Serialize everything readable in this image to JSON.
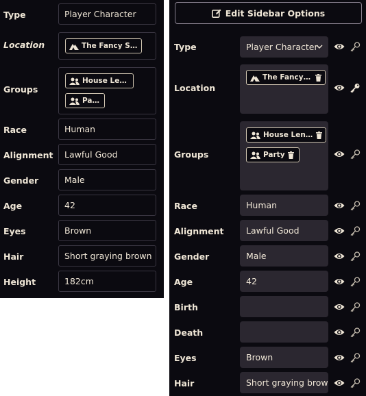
{
  "left": {
    "fields": [
      {
        "label": "Type",
        "value": "Player Character"
      },
      {
        "label": "Location",
        "tags": [
          "The Fancy Swan"
        ]
      },
      {
        "label": "Groups",
        "tags": [
          "House Lenora",
          "Party"
        ]
      },
      {
        "label": "Race",
        "value": "Human"
      },
      {
        "label": "Alignment",
        "value": "Lawful Good"
      },
      {
        "label": "Gender",
        "value": "Male"
      },
      {
        "label": "Age",
        "value": "42"
      },
      {
        "label": "Eyes",
        "value": "Brown"
      },
      {
        "label": "Hair",
        "value": "Short graying brown"
      },
      {
        "label": "Height",
        "value": "182cm"
      }
    ]
  },
  "right": {
    "edit_button": "Edit Sidebar Options",
    "fields": [
      {
        "label": "Type",
        "value": "Player Character"
      },
      {
        "label": "Location",
        "tags": [
          "The Fancy ..."
        ]
      },
      {
        "label": "Groups",
        "tags": [
          "House Len...",
          "Party"
        ]
      },
      {
        "label": "Race",
        "value": "Human"
      },
      {
        "label": "Alignment",
        "value": "Lawful Good"
      },
      {
        "label": "Gender",
        "value": "Male"
      },
      {
        "label": "Age",
        "value": "42"
      },
      {
        "label": "Birth",
        "value": ""
      },
      {
        "label": "Death",
        "value": ""
      },
      {
        "label": "Eyes",
        "value": "Brown"
      },
      {
        "label": "Hair",
        "value": "Short graying brow"
      }
    ]
  },
  "icons": {
    "location_tag": "mountain-icon",
    "group_tag": "users-icon",
    "delete": "trash-icon",
    "visibility": "eye-icon",
    "access": "key-icon",
    "edit": "edit-icon",
    "dropdown": "chevron-down-icon"
  },
  "colors": {
    "background": "#0b0a10",
    "input_background": "#2b2730",
    "text": "#efe6d6",
    "border": "#3a3642"
  }
}
